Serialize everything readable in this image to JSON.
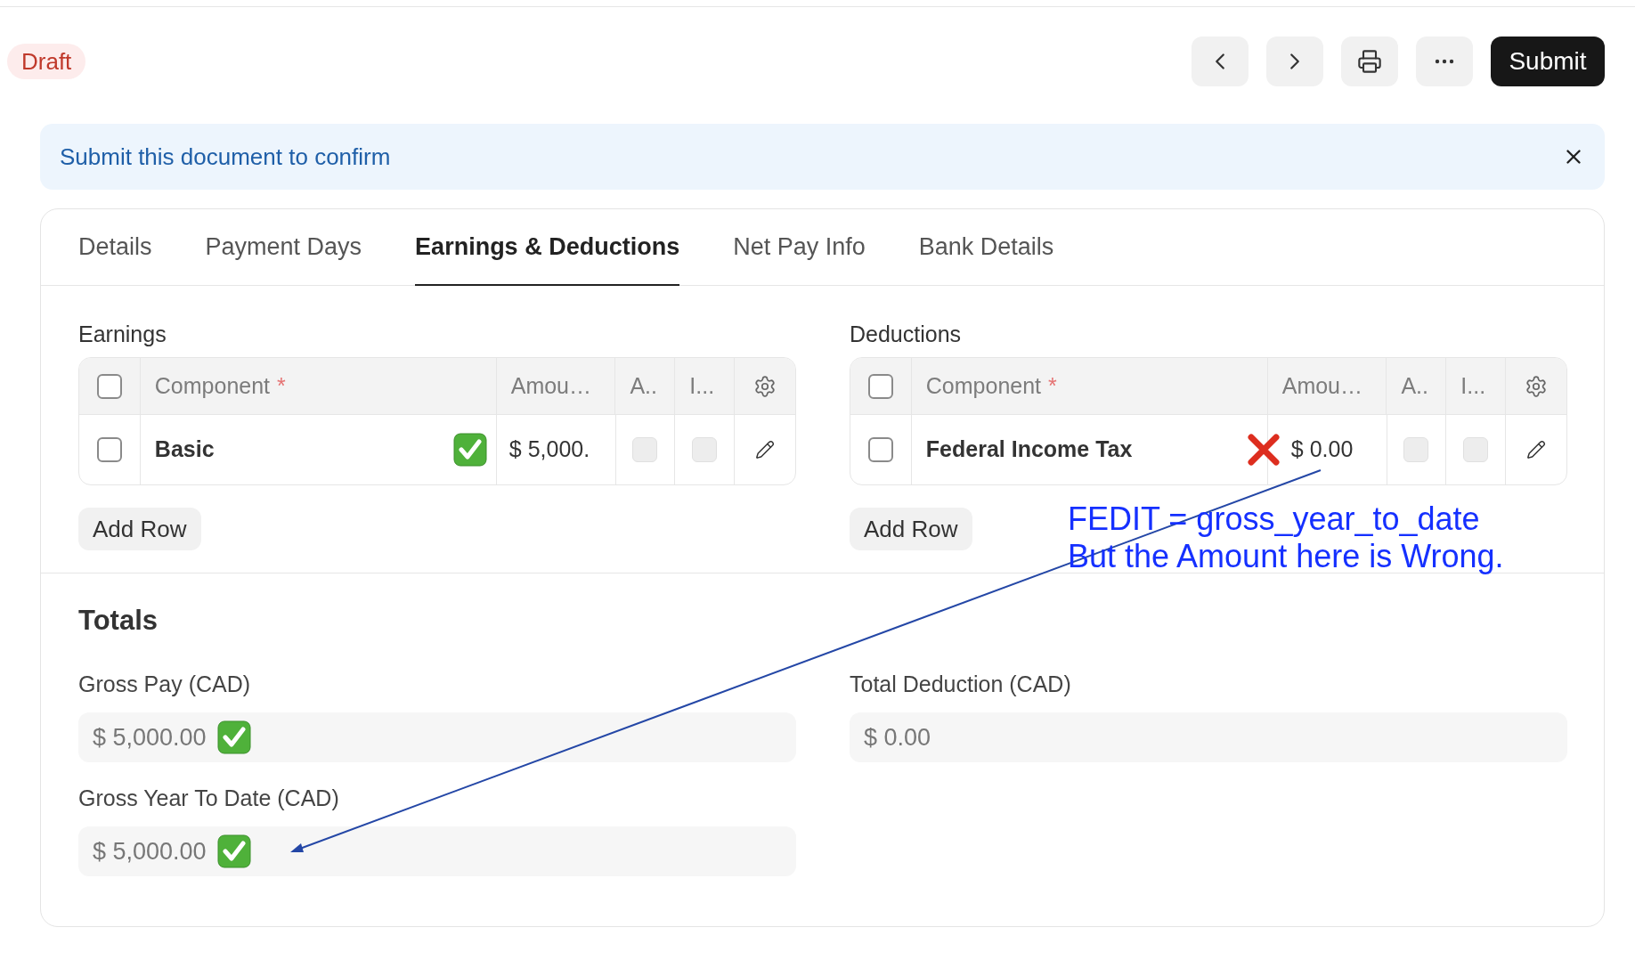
{
  "status_badge": "Draft",
  "toolbar": {
    "submit": "Submit"
  },
  "banner": {
    "message": "Submit this document to confirm"
  },
  "tabs": [
    {
      "label": "Details",
      "selected": false
    },
    {
      "label": "Payment Days",
      "selected": false
    },
    {
      "label": "Earnings & Deductions",
      "selected": true
    },
    {
      "label": "Net Pay Info",
      "selected": false
    },
    {
      "label": "Bank Details",
      "selected": false
    }
  ],
  "tables": [
    {
      "title": "Earnings",
      "header_checked": false,
      "columns": [
        {
          "label": "Component",
          "required_mark": "*"
        },
        {
          "label": "Amou…"
        },
        {
          "label": "A.."
        },
        {
          "label": "I..."
        }
      ],
      "rows": [
        {
          "checked": false,
          "component": "Basic",
          "correct": true,
          "amount": "$ 5,000.",
          "col_a": false,
          "col_i": false
        }
      ],
      "add_button": "Add Row"
    },
    {
      "title": "Deductions",
      "header_checked": false,
      "columns": [
        {
          "label": "Component",
          "required_mark": "*"
        },
        {
          "label": "Amou…"
        },
        {
          "label": "A.."
        },
        {
          "label": "I..."
        }
      ],
      "rows": [
        {
          "checked": false,
          "component": "Federal Income Tax",
          "correct": false,
          "amount": "$ 0.00",
          "col_a": false,
          "col_i": false
        }
      ],
      "add_button": "Add Row"
    }
  ],
  "totals": {
    "title": "Totals",
    "fields": [
      {
        "label": "Gross Pay (CAD)",
        "value": "$ 5,000.00",
        "correct": true
      },
      {
        "label": "Total Deduction (CAD)",
        "value": "$ 0.00"
      },
      {
        "label": "Gross Year To Date (CAD)",
        "value": "$ 5,000.00",
        "correct": true
      }
    ]
  },
  "annotation": {
    "lines": [
      "FEDIT = gross_year_to_date",
      "But the Amount here is Wrong."
    ]
  }
}
